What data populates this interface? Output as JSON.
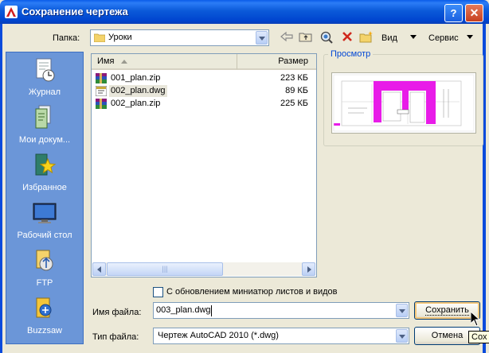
{
  "window": {
    "title": "Сохранение чертежа",
    "help_label": "?",
    "close_label": "✕"
  },
  "toolbar": {
    "folder_label": "Папка:",
    "folder_value": "Уроки",
    "view_label": "Вид",
    "tools_label": "Сервис"
  },
  "places": [
    {
      "label": "Журнал",
      "icon": "history-icon"
    },
    {
      "label": "Мои докум...",
      "icon": "my-documents-icon"
    },
    {
      "label": "Избранное",
      "icon": "favorites-icon"
    },
    {
      "label": "Рабочий стол",
      "icon": "desktop-icon"
    },
    {
      "label": "FTP",
      "icon": "ftp-icon"
    },
    {
      "label": "Buzzsaw",
      "icon": "buzzsaw-icon"
    }
  ],
  "filelist": {
    "columns": [
      "Имя",
      "Размер"
    ],
    "rows": [
      {
        "name": "001_plan.zip",
        "size": "223 КБ",
        "type": "zip"
      },
      {
        "name": "002_plan.dwg",
        "size": "89 КБ",
        "type": "dwg",
        "selected": true
      },
      {
        "name": "002_plan.zip",
        "size": "225 КБ",
        "type": "zip"
      }
    ],
    "scroll_grip": "|||"
  },
  "preview": {
    "label": "Просмотр"
  },
  "options": {
    "update_thumbnails_label": "С обновлением миниатюр листов и видов",
    "update_thumbnails_checked": false
  },
  "form": {
    "filename_label": "Имя файла:",
    "filename_value": "003_plan.dwg",
    "filetype_label": "Тип файла:",
    "filetype_value": "Чертеж AutoCAD 2010 (*.dwg)"
  },
  "buttons": {
    "save_label": "Сохранить",
    "cancel_label": "Отмена"
  },
  "tooltip": {
    "text": "Сох"
  },
  "colors": {
    "titlebar": "#0a5ce8",
    "places_bg": "#6b96d8",
    "preview_highlight": "#e81ce8"
  }
}
